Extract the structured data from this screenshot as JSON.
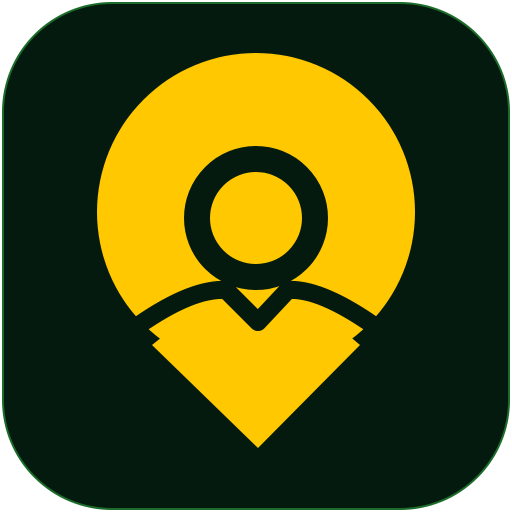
{
  "icon": {
    "name": "person-location-pin-icon",
    "colors": {
      "tile_background": "#041a0e",
      "tile_edge": "#1b6b2a",
      "pin_fill": "#ffc800",
      "person_outline": "#041a0e"
    }
  }
}
